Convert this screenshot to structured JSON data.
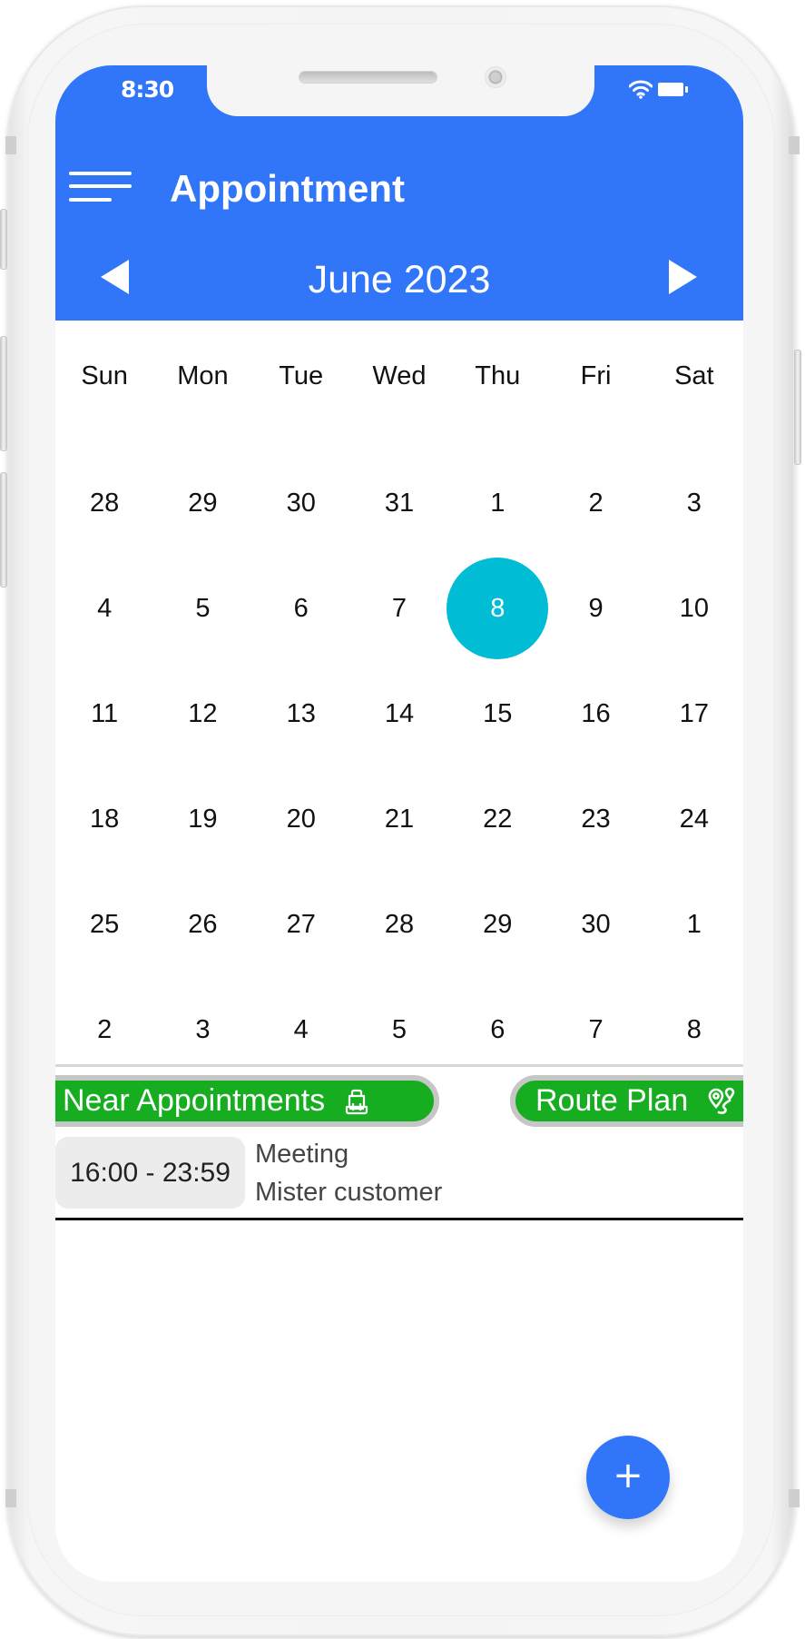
{
  "status_bar": {
    "time": "8:30",
    "icons": [
      "wifi-icon",
      "battery-icon"
    ]
  },
  "appbar": {
    "menu_icon": "hamburger-menu-icon",
    "title": "Appointment"
  },
  "calendar": {
    "month_label": "June 2023",
    "prev_icon": "triangle-left-icon",
    "next_icon": "triangle-right-icon",
    "weekdays": [
      "Sun",
      "Mon",
      "Tue",
      "Wed",
      "Thu",
      "Fri",
      "Sat"
    ],
    "weeks": [
      [
        "28",
        "29",
        "30",
        "31",
        "1",
        "2",
        "3"
      ],
      [
        "4",
        "5",
        "6",
        "7",
        "8",
        "9",
        "10"
      ],
      [
        "11",
        "12",
        "13",
        "14",
        "15",
        "16",
        "17"
      ],
      [
        "18",
        "19",
        "20",
        "21",
        "22",
        "23",
        "24"
      ],
      [
        "25",
        "26",
        "27",
        "28",
        "29",
        "30",
        "1"
      ],
      [
        "2",
        "3",
        "4",
        "5",
        "6",
        "7",
        "8"
      ]
    ],
    "selected_day": "8",
    "selected_color": "#00bcd4"
  },
  "actions": {
    "near_appointments": {
      "label": "Near Appointments",
      "icon": "backpack-icon"
    },
    "route_plan": {
      "label": "Route Plan",
      "icon": "route-pins-icon"
    },
    "color": "#17ad21"
  },
  "appointments": [
    {
      "time": "16:00 - 23:59",
      "title": "Meeting",
      "customer": "Mister customer"
    }
  ],
  "fab": {
    "label": "+",
    "icon": "plus-icon"
  },
  "colors": {
    "primary": "#3176f8"
  }
}
